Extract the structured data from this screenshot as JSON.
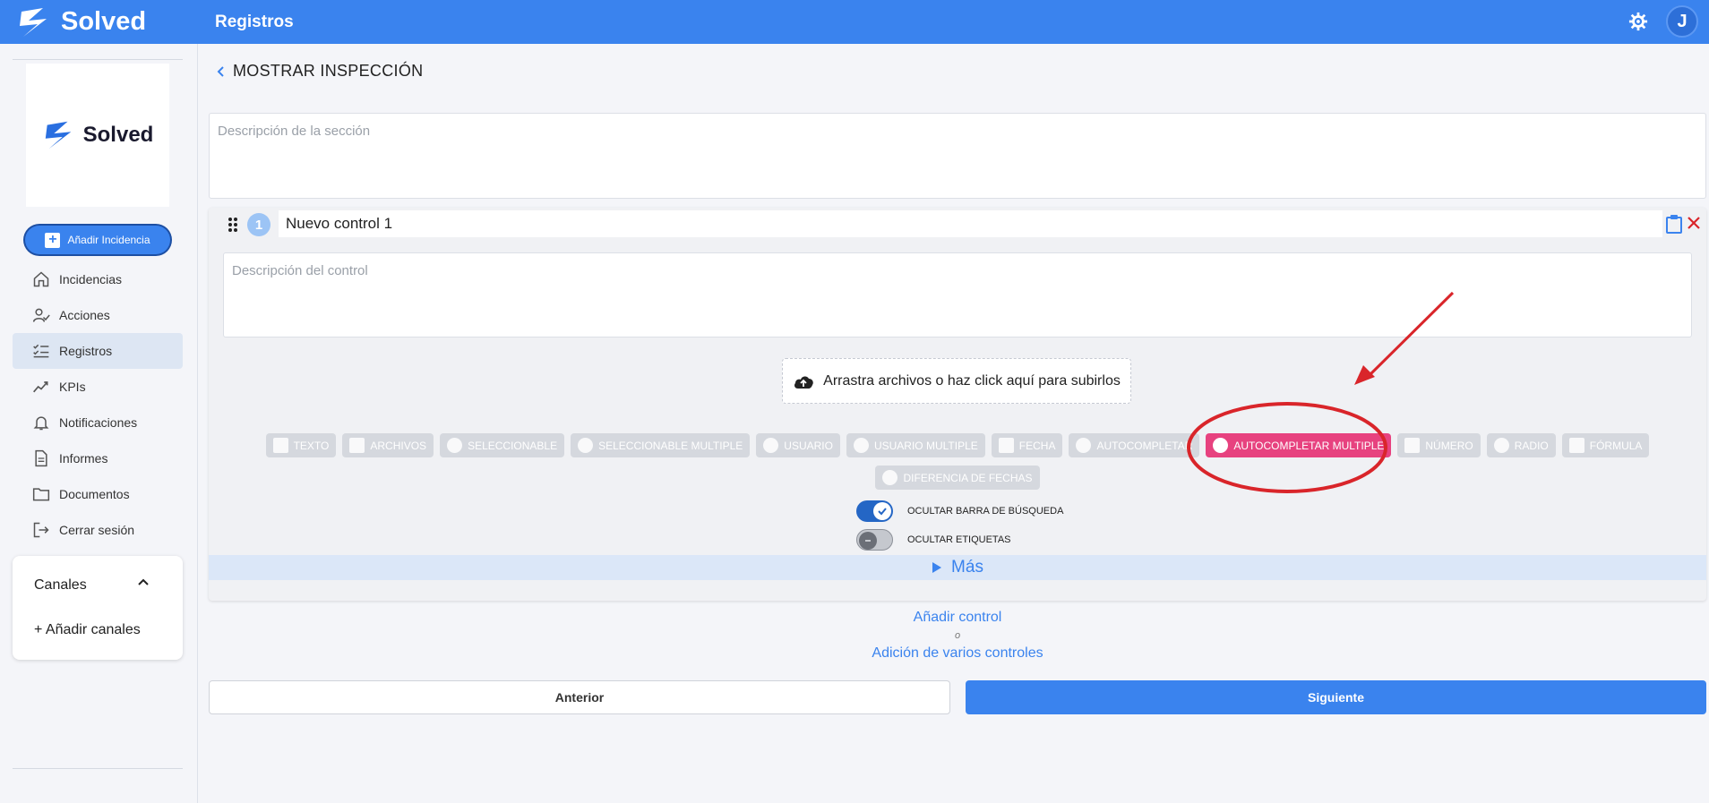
{
  "header": {
    "brand": "Solved",
    "title": "Registros",
    "avatar_initial": "J",
    "settings_icon": "gear-icon"
  },
  "sidebar": {
    "logo_text": "Solved",
    "add_button": "Añadir Incidencia",
    "items": [
      {
        "label": "Incidencias",
        "icon": "home-icon"
      },
      {
        "label": "Acciones",
        "icon": "user-check-icon"
      },
      {
        "label": "Registros",
        "icon": "checklist-icon",
        "active": true
      },
      {
        "label": "KPIs",
        "icon": "trend-icon"
      },
      {
        "label": "Notificaciones",
        "icon": "bell-icon"
      },
      {
        "label": "Informes",
        "icon": "document-icon"
      },
      {
        "label": "Documentos",
        "icon": "folder-icon"
      },
      {
        "label": "Cerrar sesión",
        "icon": "logout-icon"
      }
    ],
    "channels": {
      "title": "Canales",
      "add": "+ Añadir canales"
    }
  },
  "main": {
    "back_title": "MOSTRAR INSPECCIÓN",
    "section_description_placeholder": "Descripción de la sección",
    "control": {
      "number": "1",
      "title": "Nuevo control 1",
      "description_placeholder": "Descripción del control",
      "upload_text": "Arrastra archivos o haz click aquí para subirlos",
      "types_row1": [
        "TEXTO",
        "ARCHIVOS",
        "SELECCIONABLE",
        "SELECCIONABLE MULTIPLE",
        "USUARIO",
        "USUARIO MULTIPLE",
        "FECHA",
        "AUTOCOMPLETAR",
        "AUTOCOMPLETAR MULTIPLE",
        "NÚMERO",
        "RADIO",
        "FÓRMULA"
      ],
      "types_row2": [
        "DIFERENCIA DE FECHAS"
      ],
      "selected_type": "AUTOCOMPLETAR MULTIPLE",
      "toggle_search": {
        "label": "OCULTAR BARRA DE BÚSQUEDA",
        "on": true
      },
      "toggle_labels": {
        "label": "OCULTAR ETIQUETAS",
        "on": false
      },
      "more": "Más"
    },
    "add_control": "Añadir control",
    "or": "o",
    "add_multiple": "Adición de varios controles",
    "prev_button": "Anterior",
    "next_button": "Siguiente"
  },
  "colors": {
    "primary": "#3a83ee",
    "selected_chip": "#e7427f",
    "annotation": "#d9252a"
  }
}
